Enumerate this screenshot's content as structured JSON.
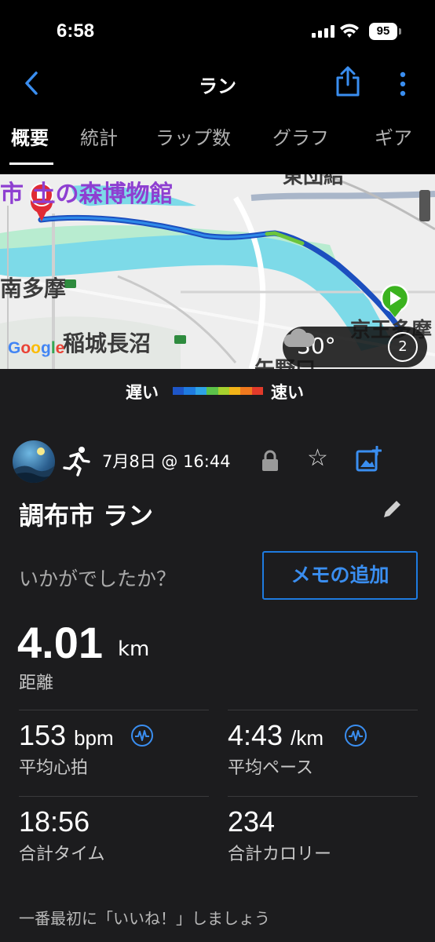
{
  "status_bar": {
    "time": "6:58",
    "battery": "95"
  },
  "header": {
    "title": "ラン"
  },
  "tabs": [
    {
      "label": "概要"
    },
    {
      "label": "統計"
    },
    {
      "label": "ラップ数"
    },
    {
      "label": "グラフ"
    },
    {
      "label": "ギア"
    }
  ],
  "map": {
    "places": {
      "museum": "市 土の森博物館",
      "tamatop": "東団給",
      "nishitama": "南多摩",
      "inagi": "稲城長沼",
      "yanokuchi": "矢野口",
      "keio": "京王多摩"
    },
    "attribution": "Google",
    "weather": {
      "temperature": "30°",
      "wind": "2"
    }
  },
  "speed_legend": {
    "slow": "遅い",
    "fast": "速い",
    "colors": [
      "#1e56c8",
      "#1f7be0",
      "#2ea3e6",
      "#5cc24a",
      "#a6d12e",
      "#f2b318",
      "#f0791e",
      "#e23a2a"
    ]
  },
  "activity": {
    "date": "7月8日 @ 16:44",
    "title": "調布市 ラン",
    "question": "いかがでしたか？",
    "memo_button": "メモの追加",
    "distance": {
      "value": "4.01",
      "unit": "km",
      "label": "距離"
    },
    "stats": {
      "heart_rate": {
        "value": "153",
        "unit": "bpm",
        "label": "平均心拍"
      },
      "pace": {
        "value": "4:43",
        "unit": "/km",
        "label": "平均ペース"
      },
      "time": {
        "value": "18:56",
        "label": "合計タイム"
      },
      "calories": {
        "value": "234",
        "label": "合計カロリー"
      }
    },
    "like_prompt": "一番最初に「いいね！」しましょう"
  }
}
